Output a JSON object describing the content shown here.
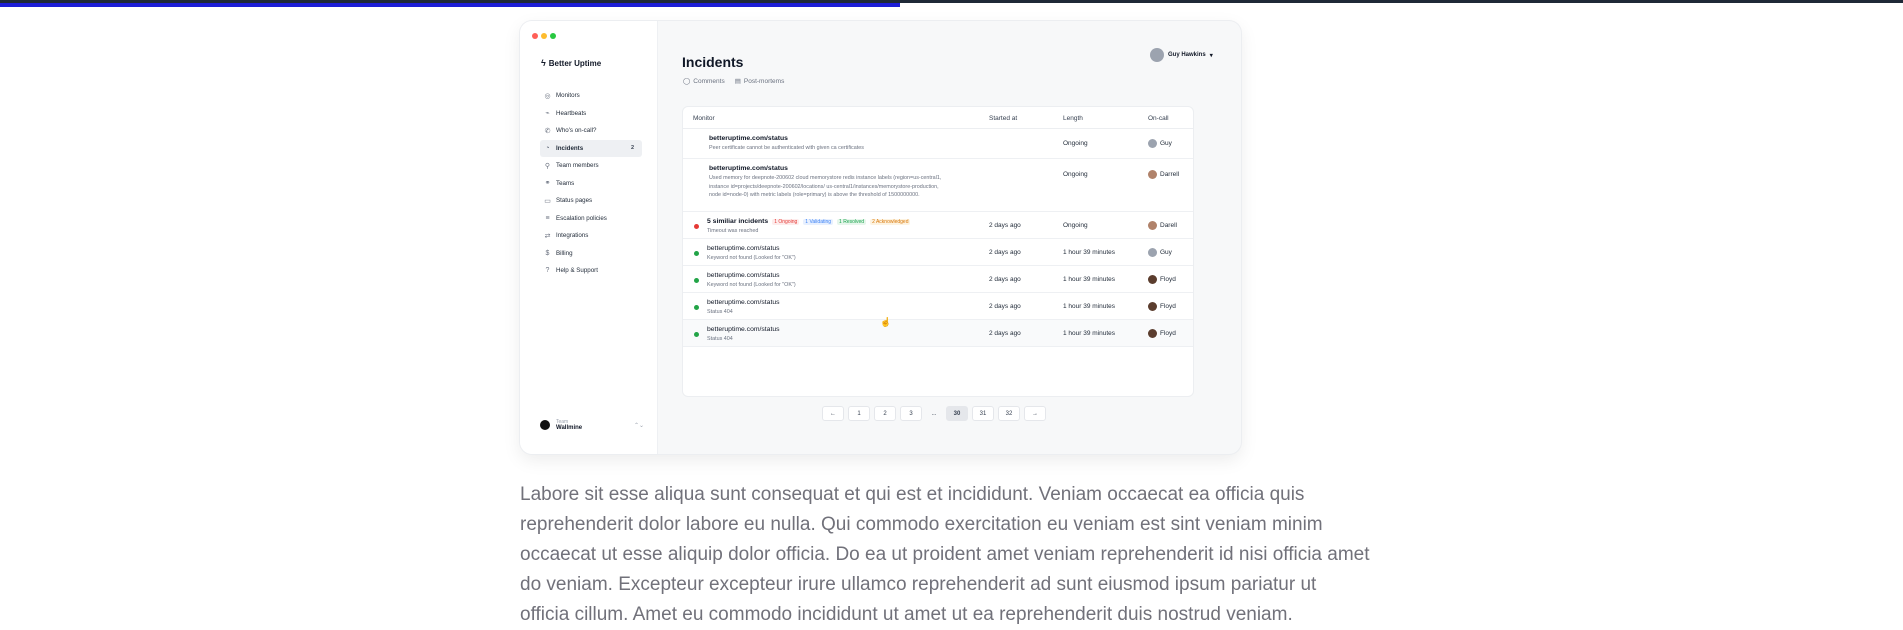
{
  "progress": {
    "percent": 47.3,
    "color": "#1d1dd6",
    "track_color": "#1f2937"
  },
  "app": {
    "traffic_colors": [
      "#ff5f57",
      "#febc2e",
      "#28c840"
    ],
    "brand": {
      "name": "Better Uptime",
      "icon": "bolt-icon"
    },
    "nav": [
      {
        "label": "Monitors",
        "icon": "globe-icon",
        "glyph": "◎",
        "badge": ""
      },
      {
        "label": "Heartbeats",
        "icon": "heartbeat-icon",
        "glyph": "⌁",
        "badge": ""
      },
      {
        "label": "Who's on-call?",
        "icon": "phone-icon",
        "glyph": "✆",
        "badge": ""
      },
      {
        "label": "Incidents",
        "icon": "shield-icon",
        "glyph": "◔",
        "badge": "2",
        "active": true
      },
      {
        "label": "Team members",
        "icon": "user-icon",
        "glyph": "⚲",
        "badge": ""
      },
      {
        "label": "Teams",
        "icon": "team-icon",
        "glyph": "⚭",
        "badge": ""
      },
      {
        "label": "Status pages",
        "icon": "status-page-icon",
        "glyph": "▭",
        "badge": ""
      },
      {
        "label": "Escalation policies",
        "icon": "escalation-icon",
        "glyph": "≡",
        "badge": ""
      },
      {
        "label": "Integrations",
        "icon": "integrations-icon",
        "glyph": "⇄",
        "badge": ""
      },
      {
        "label": "Billing",
        "icon": "billing-icon",
        "glyph": "$",
        "badge": ""
      },
      {
        "label": "Help & Support",
        "icon": "help-icon",
        "glyph": "?",
        "badge": ""
      }
    ],
    "team": {
      "sub": "Team",
      "name": "Wallmine",
      "chevron": "⌃⌄"
    },
    "page_title": "Incidents",
    "subtabs": [
      {
        "label": "Comments",
        "icon": "comment-icon",
        "glyph": "◯"
      },
      {
        "label": "Post-mortems",
        "icon": "document-icon",
        "glyph": "▤"
      }
    ],
    "user": {
      "name": "Guy Hawkins",
      "caret": "▾"
    },
    "table": {
      "columns": {
        "monitor": "Monitor",
        "started": "Started at",
        "length": "Length",
        "oncall": "On-call"
      },
      "rows": [
        {
          "title": "betteruptime.com/status",
          "desc": "Peer certificate cannot be authenticated with given ca certificates",
          "started": "",
          "length": "Ongoing",
          "oncall": "Guy",
          "status": "",
          "tags": []
        },
        {
          "title": "betteruptime.com/status",
          "desc": "Used memory for deepnote-200602 cloud memorystore redis instance labels (region=us-central1, instance id=projects/deepnote-200602/locations/ us-central1/instances/memorystore-production, node id=node-0) with metric labels (role=primary) is above the threshold of 1500000000.",
          "started": "",
          "length": "Ongoing",
          "oncall": "Darrell",
          "status": "",
          "tags": []
        },
        {
          "title": "5 similiar incidents",
          "desc": "Timeout was reached",
          "started": "2 days ago",
          "length": "Ongoing",
          "oncall": "Darell",
          "status": "red",
          "tags": [
            {
              "label": "1 Ongoing",
              "color": "#e53935",
              "bg": "#fdecec"
            },
            {
              "label": "1 Validating",
              "color": "#3b82f6",
              "bg": "#e8f0fe"
            },
            {
              "label": "1 Resolved",
              "color": "#16a34a",
              "bg": "#e7f6ec"
            },
            {
              "label": "2 Acknowledged",
              "color": "#d97706",
              "bg": "#fdf3e1"
            }
          ]
        },
        {
          "title": "betteruptime.com/status",
          "desc": "Keyword not found (Looked for \"OK\")",
          "started": "2 days ago",
          "length": "1 hour 39 minutes",
          "oncall": "Guy",
          "status": "green",
          "tags": []
        },
        {
          "title": "betteruptime.com/status",
          "desc": "Keyword not found (Looked for \"OK\")",
          "started": "2 days ago",
          "length": "1 hour 39 minutes",
          "oncall": "Floyd",
          "status": "green",
          "tags": []
        },
        {
          "title": "betteruptime.com/status",
          "desc": "Status 404",
          "started": "2 days ago",
          "length": "1 hour 39 minutes",
          "oncall": "Floyd",
          "status": "green",
          "tags": []
        },
        {
          "title": "betteruptime.com/status",
          "desc": "Status 404",
          "started": "2 days ago",
          "length": "1 hour 39 minutes",
          "oncall": "Floyd",
          "status": "green",
          "tags": []
        }
      ]
    },
    "pagination": {
      "prev": "←",
      "next": "→",
      "ellipsis": "...",
      "pages": [
        "1",
        "2",
        "3"
      ],
      "pages_end": [
        "30",
        "31",
        "32"
      ],
      "active": "30"
    }
  },
  "body_copy": "Labore sit esse aliqua sunt consequat et qui est et incididunt. Veniam occaecat ea officia quis reprehenderit dolor labore eu nulla. Qui commodo exercitation eu veniam est sint veniam minim occaecat ut esse aliquip dolor officia. Do ea ut proident amet veniam reprehenderit id nisi officia amet do veniam. Excepteur excepteur irure ullamco reprehenderit ad sunt eiusmod ipsum pariatur ut officia cillum. Amet eu commodo incididunt ut amet ut ea reprehenderit duis nostrud veniam."
}
